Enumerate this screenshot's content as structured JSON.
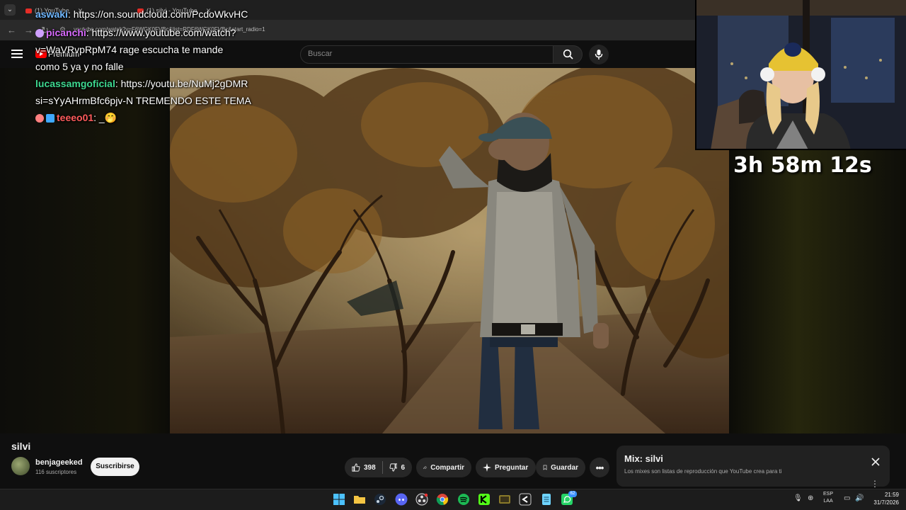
{
  "browser": {
    "tabs": [
      {
        "label": "(1) YouTube"
      },
      {
        "label": "(1) silvi - YouTube"
      }
    ],
    "url": "youtube.com/watch?v=F6WGK0FVBc&list=RDF6WGK0FVBc&start_radio=1"
  },
  "youtube": {
    "logo_label": "Premium",
    "search_placeholder": "Buscar"
  },
  "chat": {
    "messages": [
      {
        "user": "aswaki",
        "text": ": https://on.soundcloud.com/PcdoWkvHC"
      },
      {
        "user": "picanchi",
        "text": ": https://www.youtube.com/watch?",
        "cont1": "v=WaVRvpRpM74 rage escucha te mande",
        "cont2": "como 5 ya y no falle"
      },
      {
        "user": "lucassamgoficial",
        "text": ": https://youtu.be/NuMj2gDMR",
        "cont1": "si=sYyAHrmBfc6pjv-N TREMENDO ESTE TEMA"
      },
      {
        "user": "teeeo01",
        "text": ":  _🤭"
      }
    ]
  },
  "stream": {
    "timer": "3h 58m 12s"
  },
  "video": {
    "title": "silvi",
    "channel": "benjageeked",
    "subscribers": "116 suscriptores",
    "subscribe_label": "Suscribirse",
    "likes": "398",
    "dislikes": "6",
    "share_label": "Compartir",
    "ask_label": "Preguntar",
    "save_label": "Guardar"
  },
  "mix": {
    "title": "Mix: silvi",
    "subtitle": "Los mixes son listas de reproducción que YouTube crea para ti"
  },
  "taskbar": {
    "lang_line1": "ESP",
    "lang_line2": "LAA",
    "time": "21:59",
    "date": "31/7/2026",
    "whatsapp_badge": "62"
  },
  "colors": {
    "chat_user_aswaki": "#6fb7ff",
    "chat_user_picanchi": "#d86bff",
    "chat_user_lucassamgoficial": "#3ed88f",
    "chat_user_teeeo01": "#ff5b5b",
    "youtube_red": "#ff0000"
  }
}
